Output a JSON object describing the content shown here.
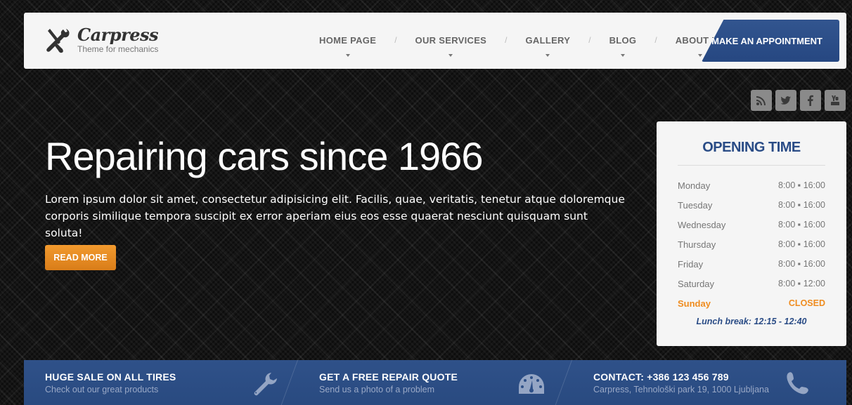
{
  "brand": {
    "name": "Carpress",
    "tagline": "Theme for mechanics",
    "icon": "wrench-screwdriver-icon"
  },
  "nav": {
    "items": [
      {
        "label": "HOME PAGE"
      },
      {
        "label": "OUR SERVICES"
      },
      {
        "label": "GALLERY"
      },
      {
        "label": "BLOG"
      },
      {
        "label": "ABOUT US"
      }
    ],
    "separator": "/",
    "cta_label": "MAKE AN APPOINTMENT"
  },
  "social": [
    "rss-icon",
    "twitter-icon",
    "facebook-icon",
    "youtube-icon"
  ],
  "hero": {
    "title": "Repairing cars since 1966",
    "text": "Lorem ipsum dolor sit amet, consectetur adipisicing elit. Facilis, quae, veritatis, tenetur atque doloremque corporis similique tempora suscipit ex error aperiam eius eos esse quaerat nesciunt quisquam sunt soluta!",
    "button_label": "READ MORE"
  },
  "hours": {
    "title": "OPENING TIME",
    "rows": [
      {
        "day": "Monday",
        "time": "8:00 ▪ 16:00"
      },
      {
        "day": "Tuesday",
        "time": "8:00 ▪ 16:00"
      },
      {
        "day": "Wednesday",
        "time": "8:00 ▪ 16:00"
      },
      {
        "day": "Thursday",
        "time": "8:00 ▪ 16:00"
      },
      {
        "day": "Friday",
        "time": "8:00 ▪ 16:00"
      },
      {
        "day": "Saturday",
        "time": "8:00 ▪ 12:00"
      },
      {
        "day": "Sunday",
        "time": "CLOSED"
      }
    ],
    "lunch": "Lunch break: 12:15 - 12:40",
    "accent_color": "#2a4c86",
    "closed_color": "#ef8c1f"
  },
  "info_bar": [
    {
      "title": "HUGE SALE ON ALL TIRES",
      "subtitle": "Check out our great products",
      "icon": "wrench-icon"
    },
    {
      "title": "GET A FREE REPAIR QUOTE",
      "subtitle": "Send us a photo of a problem",
      "icon": "dashboard-icon"
    },
    {
      "title": "CONTACT: +386 123 456 789",
      "subtitle": "Carpress, Tehnološki park 19, 1000 Ljubljana",
      "icon": "phone-icon"
    }
  ]
}
